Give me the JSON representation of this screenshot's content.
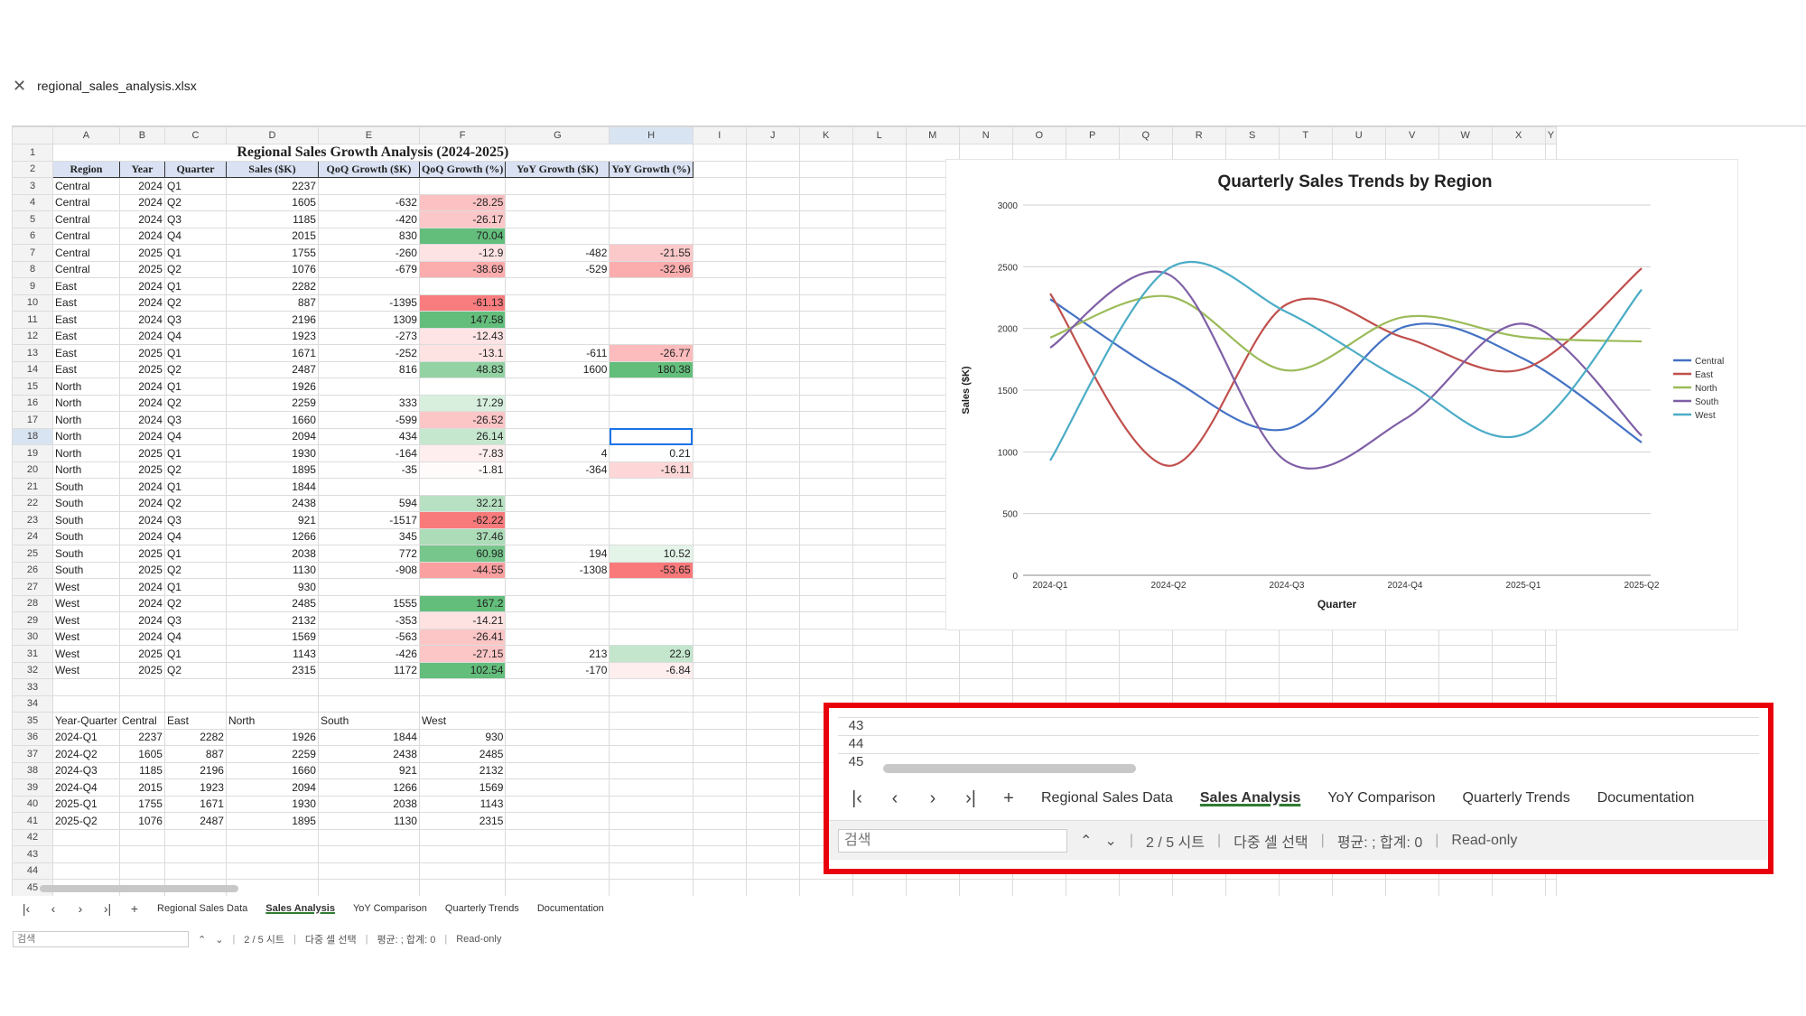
{
  "app": {
    "filename": "regional_sales_analysis.xlsx",
    "close_icon": "close-icon"
  },
  "columns": [
    "A",
    "B",
    "C",
    "D",
    "E",
    "F",
    "G",
    "H",
    "I",
    "J",
    "K",
    "L",
    "M",
    "N",
    "O",
    "P",
    "Q",
    "R",
    "S",
    "T",
    "U",
    "V",
    "W",
    "X",
    "Y"
  ],
  "sheet": {
    "title": "Regional Sales Growth Analysis (2024-2025)",
    "headers": [
      "Region",
      "Year",
      "Quarter",
      "Sales ($K)",
      "QoQ Growth ($K)",
      "QoQ Growth (%)",
      "YoY Growth ($K)",
      "YoY Growth (%)"
    ],
    "rows": [
      [
        "Central",
        "2024",
        "Q1",
        "2237",
        "",
        "",
        "",
        ""
      ],
      [
        "Central",
        "2024",
        "Q2",
        "1605",
        "-632",
        "-28.25",
        "",
        ""
      ],
      [
        "Central",
        "2024",
        "Q3",
        "1185",
        "-420",
        "-26.17",
        "",
        ""
      ],
      [
        "Central",
        "2024",
        "Q4",
        "2015",
        "830",
        "70.04",
        "",
        ""
      ],
      [
        "Central",
        "2025",
        "Q1",
        "1755",
        "-260",
        "-12.9",
        "-482",
        "-21.55"
      ],
      [
        "Central",
        "2025",
        "Q2",
        "1076",
        "-679",
        "-38.69",
        "-529",
        "-32.96"
      ],
      [
        "East",
        "2024",
        "Q1",
        "2282",
        "",
        "",
        "",
        ""
      ],
      [
        "East",
        "2024",
        "Q2",
        "887",
        "-1395",
        "-61.13",
        "",
        ""
      ],
      [
        "East",
        "2024",
        "Q3",
        "2196",
        "1309",
        "147.58",
        "",
        ""
      ],
      [
        "East",
        "2024",
        "Q4",
        "1923",
        "-273",
        "-12.43",
        "",
        ""
      ],
      [
        "East",
        "2025",
        "Q1",
        "1671",
        "-252",
        "-13.1",
        "-611",
        "-26.77"
      ],
      [
        "East",
        "2025",
        "Q2",
        "2487",
        "816",
        "48.83",
        "1600",
        "180.38"
      ],
      [
        "North",
        "2024",
        "Q1",
        "1926",
        "",
        "",
        "",
        ""
      ],
      [
        "North",
        "2024",
        "Q2",
        "2259",
        "333",
        "17.29",
        "",
        ""
      ],
      [
        "North",
        "2024",
        "Q3",
        "1660",
        "-599",
        "-26.52",
        "",
        ""
      ],
      [
        "North",
        "2024",
        "Q4",
        "2094",
        "434",
        "26.14",
        "",
        ""
      ],
      [
        "North",
        "2025",
        "Q1",
        "1930",
        "-164",
        "-7.83",
        "4",
        "0.21"
      ],
      [
        "North",
        "2025",
        "Q2",
        "1895",
        "-35",
        "-1.81",
        "-364",
        "-16.11"
      ],
      [
        "South",
        "2024",
        "Q1",
        "1844",
        "",
        "",
        "",
        ""
      ],
      [
        "South",
        "2024",
        "Q2",
        "2438",
        "594",
        "32.21",
        "",
        ""
      ],
      [
        "South",
        "2024",
        "Q3",
        "921",
        "-1517",
        "-62.22",
        "",
        ""
      ],
      [
        "South",
        "2024",
        "Q4",
        "1266",
        "345",
        "37.46",
        "",
        ""
      ],
      [
        "South",
        "2025",
        "Q1",
        "2038",
        "772",
        "60.98",
        "194",
        "10.52"
      ],
      [
        "South",
        "2025",
        "Q2",
        "1130",
        "-908",
        "-44.55",
        "-1308",
        "-53.65"
      ],
      [
        "West",
        "2024",
        "Q1",
        "930",
        "",
        "",
        "",
        ""
      ],
      [
        "West",
        "2024",
        "Q2",
        "2485",
        "1555",
        "167.2",
        "",
        ""
      ],
      [
        "West",
        "2024",
        "Q3",
        "2132",
        "-353",
        "-14.21",
        "",
        ""
      ],
      [
        "West",
        "2024",
        "Q4",
        "1569",
        "-563",
        "-26.41",
        "",
        ""
      ],
      [
        "West",
        "2025",
        "Q1",
        "1143",
        "-426",
        "-27.15",
        "213",
        "22.9"
      ],
      [
        "West",
        "2025",
        "Q2",
        "2315",
        "1172",
        "102.54",
        "-170",
        "-6.84"
      ]
    ],
    "pivot_headers": [
      "Year-Quarter",
      "Central",
      "East",
      "North",
      "South",
      "West"
    ],
    "pivot_rows": [
      [
        "2024-Q1",
        "2237",
        "2282",
        "1926",
        "1844",
        "930"
      ],
      [
        "2024-Q2",
        "1605",
        "887",
        "2259",
        "2438",
        "2485"
      ],
      [
        "2024-Q3",
        "1185",
        "2196",
        "1660",
        "921",
        "2132"
      ],
      [
        "2024-Q4",
        "2015",
        "1923",
        "2094",
        "1266",
        "1569"
      ],
      [
        "2025-Q1",
        "1755",
        "1671",
        "1930",
        "2038",
        "1143"
      ],
      [
        "2025-Q2",
        "1076",
        "2487",
        "1895",
        "1130",
        "2315"
      ]
    ]
  },
  "sheet_tabs": {
    "tabs": [
      "Regional Sales Data",
      "Sales Analysis",
      "YoY Comparison",
      "Quarterly Trends",
      "Documentation"
    ],
    "active": 1,
    "add_label": "+"
  },
  "status": {
    "search_placeholder": "검색",
    "sheet_count": "2 / 5 시트",
    "multi_select": "다중 셀 선택",
    "avg_sum": "평균: ; 합계: 0",
    "readonly": "Read-only"
  },
  "zoom_rows": [
    "43",
    "44",
    "45"
  ],
  "colors": {
    "pos_strong": "#63be7b",
    "pos_light": "#e6f3e8",
    "neg_strong": "#f8696b",
    "neg_light": "#fde0e0",
    "accent": "#1a73e8",
    "highlight_box": "#e8000b"
  },
  "chart_data": {
    "type": "line",
    "title": "Quarterly Sales Trends by Region",
    "xlabel": "Quarter",
    "ylabel": "Sales ($K)",
    "categories": [
      "2024-Q1",
      "2024-Q2",
      "2024-Q3",
      "2024-Q4",
      "2025-Q1",
      "2025-Q2"
    ],
    "ylim": [
      0,
      3000
    ],
    "yticks": [
      0,
      500,
      1000,
      1500,
      2000,
      2500,
      3000
    ],
    "legend": "right",
    "smooth": true,
    "series": [
      {
        "name": "Central",
        "color": "#4472c4",
        "values": [
          2237,
          1605,
          1185,
          2015,
          1755,
          1076
        ]
      },
      {
        "name": "East",
        "color": "#c0504d",
        "values": [
          2282,
          887,
          2196,
          1923,
          1671,
          2487
        ]
      },
      {
        "name": "North",
        "color": "#9bbb59",
        "values": [
          1926,
          2259,
          1660,
          2094,
          1930,
          1895
        ]
      },
      {
        "name": "South",
        "color": "#7f5fa6",
        "values": [
          1844,
          2438,
          921,
          1266,
          2038,
          1130
        ]
      },
      {
        "name": "West",
        "color": "#4bacc6",
        "values": [
          930,
          2485,
          2132,
          1569,
          1143,
          2315
        ]
      }
    ]
  }
}
